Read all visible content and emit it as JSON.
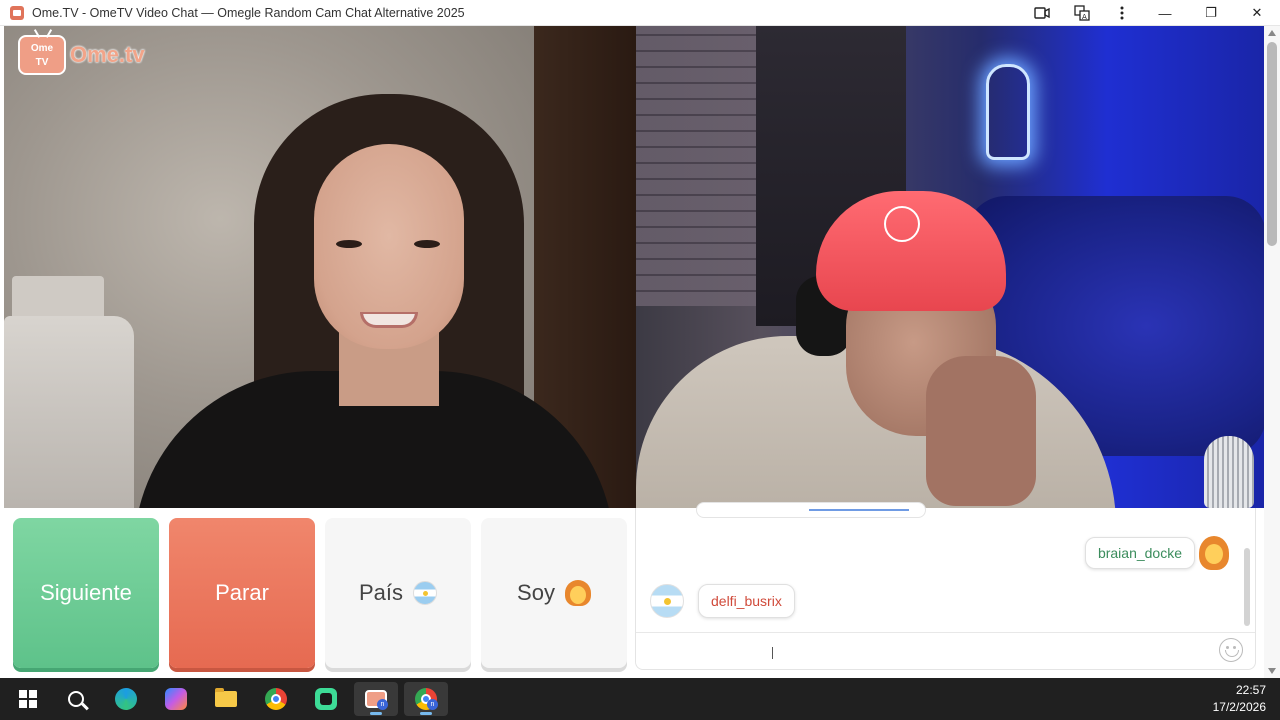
{
  "window": {
    "title": "Ome.TV - OmeTV Video Chat — Omegle Random Cam Chat Alternative 2025",
    "icons": [
      "camera-icon",
      "translate-icon",
      "more-vertical-icon"
    ],
    "controls": {
      "minimize": "—",
      "restore": "❐",
      "close": "✕"
    }
  },
  "logo": {
    "badge": "Ome\nTV",
    "text": "Ome.tv"
  },
  "buttons": {
    "next": "Siguiente",
    "stop": "Parar",
    "country": "País",
    "soy": "Soy"
  },
  "chat": {
    "messages": [
      {
        "side": "right",
        "user": "braian_docke",
        "avatar": "girl-emoji-icon",
        "color": "#3c8d5d"
      },
      {
        "side": "left",
        "user": "delfi_busrix",
        "avatar": "argentina-flag-icon",
        "color": "#d04a3a"
      }
    ],
    "input_value": ""
  },
  "taskbar": {
    "apps": [
      "windows-start-icon",
      "search-icon",
      "edge-icon",
      "copilot-icon",
      "file-explorer-icon",
      "chrome-icon",
      "green-app-icon",
      "ometv-app-icon",
      "chrome-profile-icon"
    ],
    "time": "22:57",
    "date": "17/2/2026"
  },
  "colors": {
    "next_button": "#6ccd96",
    "stop_button": "#ea7559",
    "neutral_button": "#f6f6f6",
    "logo": "#ef9e86"
  }
}
